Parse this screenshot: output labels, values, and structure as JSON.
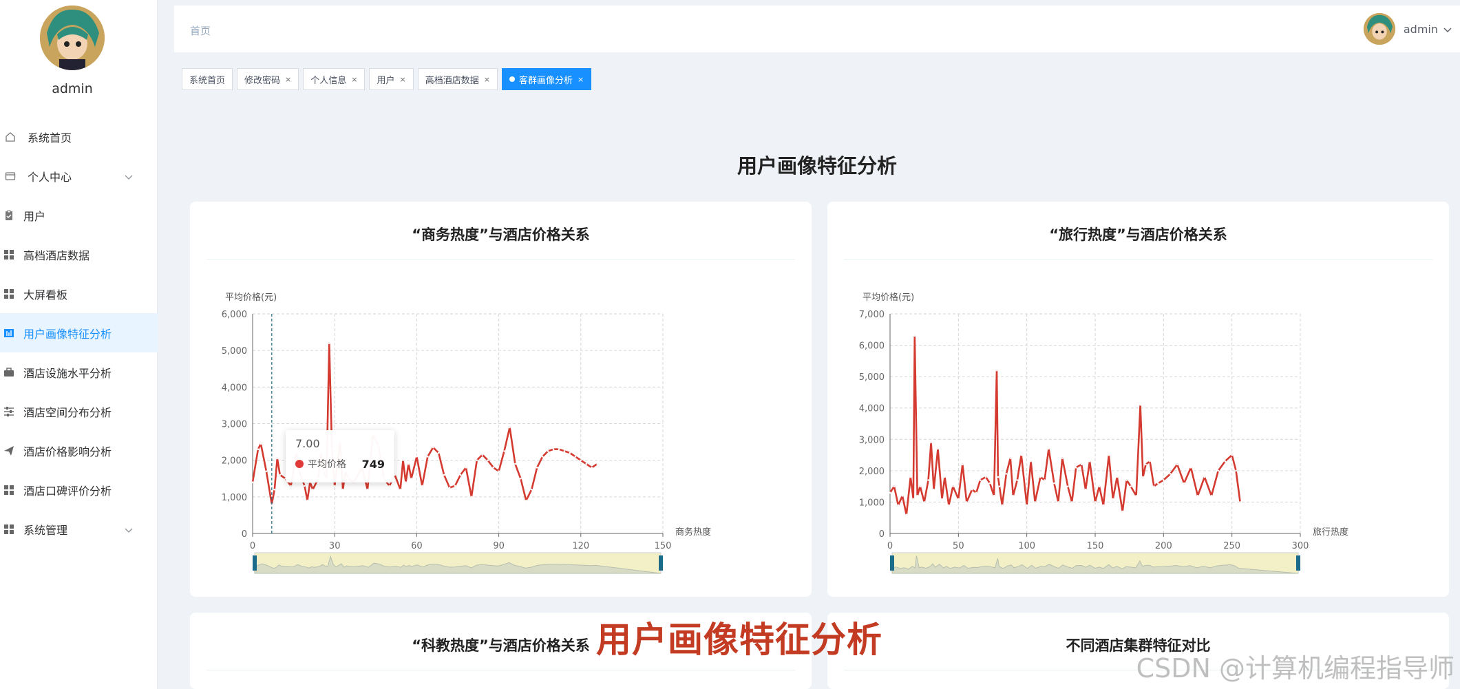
{
  "sidebar": {
    "username": "admin",
    "items": [
      {
        "label": "系统首页",
        "icon": "home-icon",
        "active": false
      },
      {
        "label": "个人中心",
        "icon": "user-card-icon",
        "active": false,
        "expandable": true
      },
      {
        "label": "用户",
        "icon": "clipboard-icon",
        "active": false
      },
      {
        "label": "高档酒店数据",
        "icon": "grid-icon",
        "active": false
      },
      {
        "label": "大屏看板",
        "icon": "grid-icon",
        "active": false
      },
      {
        "label": "用户画像特征分析",
        "icon": "chart-book-icon",
        "active": true
      },
      {
        "label": "酒店设施水平分析",
        "icon": "briefcase-icon",
        "active": false
      },
      {
        "label": "酒店空间分布分析",
        "icon": "sliders-icon",
        "active": false
      },
      {
        "label": "酒店价格影响分析",
        "icon": "send-icon",
        "active": false
      },
      {
        "label": "酒店口碑评价分析",
        "icon": "grid-icon",
        "active": false
      },
      {
        "label": "系统管理",
        "icon": "grid-icon",
        "active": false,
        "expandable": true
      }
    ]
  },
  "header": {
    "breadcrumb": "首页",
    "username": "admin"
  },
  "tags": [
    {
      "label": "系统首页",
      "closable": false,
      "active": false
    },
    {
      "label": "修改密码",
      "closable": true,
      "active": false
    },
    {
      "label": "个人信息",
      "closable": true,
      "active": false
    },
    {
      "label": "用户",
      "closable": true,
      "active": false
    },
    {
      "label": "高档酒店数据",
      "closable": true,
      "active": false
    },
    {
      "label": "客群画像分析",
      "closable": true,
      "active": true
    }
  ],
  "tag_close_glyph": "×",
  "page_title": "用户画像特征分析",
  "colors": {
    "accent": "#1890ff",
    "series": "#d43a2f",
    "slider_bg": "#f3efc7",
    "slider_handle": "#1d6b8a"
  },
  "cards": [
    {
      "title": "“商务热度”与酒店价格关系"
    },
    {
      "title": "“旅行热度”与酒店价格关系"
    },
    {
      "title": "“科教热度”与酒店价格关系"
    },
    {
      "title": "不同酒店集群特征对比"
    }
  ],
  "chart_data": [
    {
      "type": "line",
      "ylabel": "平均价格(元)",
      "xlabel": "商务热度",
      "xlim": [
        0,
        150
      ],
      "ylim": [
        0,
        6000
      ],
      "xticks": [
        0,
        30,
        60,
        90,
        120,
        150
      ],
      "yticks": [
        0,
        1000,
        2000,
        3000,
        4000,
        5000,
        6000
      ],
      "ytick_labels": [
        "0",
        "1,000",
        "2,000",
        "3,000",
        "4,000",
        "5,000",
        "6,000"
      ],
      "grid": true,
      "series": [
        {
          "x": [
            0,
            2,
            3,
            5,
            7,
            8,
            9,
            10,
            12,
            14,
            16,
            17,
            19,
            20,
            21,
            22,
            24,
            25,
            26,
            27,
            28,
            29,
            30,
            31,
            32,
            33,
            34,
            35,
            37,
            40,
            42,
            44,
            46,
            48,
            50,
            52,
            54,
            55,
            56,
            57,
            58,
            60,
            62,
            64,
            66,
            68,
            70,
            72,
            74,
            76,
            78,
            80,
            82,
            84,
            86,
            88,
            90,
            92,
            94,
            96,
            98,
            100,
            102,
            104,
            106,
            108,
            110,
            112,
            114,
            116,
            118,
            120,
            122,
            124,
            126
          ],
          "y": [
            1400,
            2300,
            2450,
            1700,
            800,
            1200,
            2050,
            1600,
            1500,
            1300,
            2200,
            1700,
            1300,
            900,
            1400,
            1200,
            1500,
            2200,
            1700,
            1500,
            5200,
            2300,
            1300,
            1900,
            2500,
            1200,
            1700,
            1500,
            1400,
            1800,
            1200,
            2700,
            2400,
            1500,
            1300,
            1600,
            1200,
            2000,
            1400,
            1900,
            1500,
            2100,
            1300,
            2100,
            2350,
            2200,
            1600,
            1250,
            1300,
            1600,
            1800,
            1000,
            2000,
            2150,
            2000,
            1800,
            1700,
            2250,
            2900,
            1900,
            1500,
            900,
            1200,
            1800,
            2100,
            2250,
            2300,
            2300,
            2250,
            2200,
            2100,
            2000,
            1900,
            1800,
            1900
          ],
          "name": "平均价格"
        }
      ],
      "tooltip": {
        "x": "7.00",
        "series": "平均价格",
        "value": "749"
      },
      "data_zoom": [
        0,
        100
      ]
    },
    {
      "type": "line",
      "ylabel": "平均价格(元)",
      "xlabel": "旅行热度",
      "xlim": [
        0,
        300
      ],
      "ylim": [
        0,
        7000
      ],
      "xticks": [
        0,
        50,
        100,
        150,
        200,
        250,
        300
      ],
      "yticks": [
        0,
        1000,
        2000,
        3000,
        4000,
        5000,
        6000,
        7000
      ],
      "ytick_labels": [
        "0",
        "1,000",
        "2,000",
        "3,000",
        "4,000",
        "5,000",
        "6,000",
        "7,000"
      ],
      "grid": true,
      "series": [
        {
          "x": [
            0,
            3,
            6,
            9,
            12,
            15,
            17,
            18,
            20,
            22,
            25,
            28,
            30,
            32,
            35,
            38,
            40,
            43,
            46,
            50,
            53,
            56,
            60,
            63,
            66,
            70,
            73,
            76,
            78,
            79,
            80,
            82,
            85,
            88,
            90,
            93,
            96,
            100,
            103,
            106,
            110,
            113,
            116,
            120,
            123,
            126,
            130,
            133,
            136,
            140,
            143,
            146,
            150,
            153,
            156,
            160,
            163,
            166,
            170,
            173,
            176,
            180,
            183,
            185,
            187,
            190,
            193,
            196,
            200,
            205,
            210,
            215,
            220,
            225,
            230,
            235,
            240,
            245,
            250,
            253,
            256
          ],
          "y": [
            1300,
            1500,
            900,
            1200,
            600,
            1800,
            1100,
            6300,
            1200,
            1500,
            1000,
            1700,
            2900,
            1400,
            2700,
            1100,
            1800,
            900,
            1500,
            1100,
            2200,
            1000,
            1400,
            1300,
            1700,
            1800,
            1600,
            1200,
            5200,
            1800,
            1500,
            900,
            1900,
            2400,
            1200,
            1700,
            2500,
            900,
            2300,
            1000,
            1800,
            1700,
            2700,
            1600,
            1000,
            2400,
            1500,
            1000,
            2100,
            2200,
            1400,
            2300,
            1000,
            1500,
            900,
            2500,
            1100,
            1800,
            700,
            1700,
            1500,
            1200,
            4100,
            1800,
            2200,
            2300,
            1500,
            1600,
            1700,
            1900,
            2200,
            1600,
            2100,
            1200,
            1800,
            1200,
            2000,
            2300,
            2500,
            2000,
            1000
          ],
          "name": "平均价格"
        }
      ],
      "data_zoom": [
        0,
        100
      ]
    }
  ],
  "overlay_text": "用户画像特征分析",
  "watermark": "CSDN @计算机编程指导师"
}
